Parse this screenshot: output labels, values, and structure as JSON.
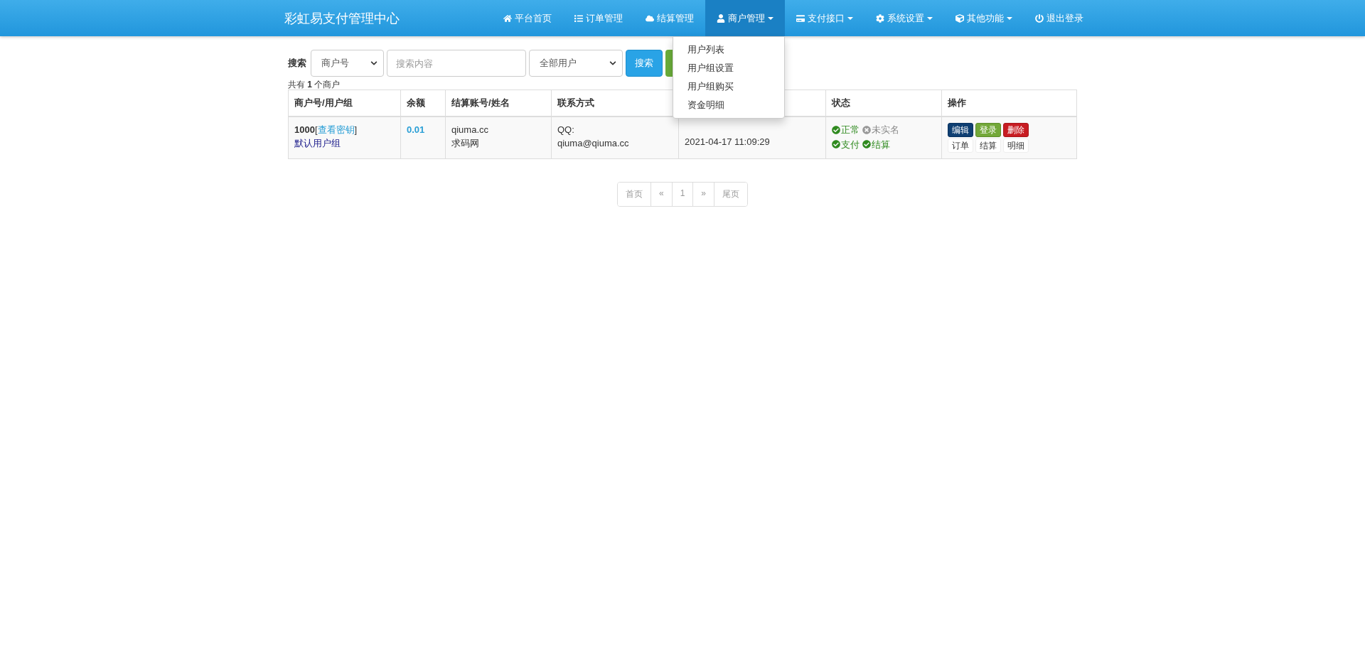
{
  "navbar": {
    "brand": "彩虹易支付管理中心",
    "items": [
      {
        "label": "平台首页",
        "selected": false,
        "dropdown": false
      },
      {
        "label": "订单管理",
        "selected": false,
        "dropdown": false
      },
      {
        "label": "结算管理",
        "selected": false,
        "dropdown": false
      },
      {
        "label": "商户管理",
        "selected": true,
        "dropdown": true
      },
      {
        "label": "支付接口",
        "selected": false,
        "dropdown": true
      },
      {
        "label": "系统设置",
        "selected": false,
        "dropdown": true
      },
      {
        "label": "其他功能",
        "selected": false,
        "dropdown": true
      },
      {
        "label": "退出登录",
        "selected": false,
        "dropdown": false
      }
    ]
  },
  "dropdown_menu": {
    "items": [
      "用户列表",
      "用户组设置",
      "用户组购买",
      "资金明细"
    ]
  },
  "search": {
    "label": "搜索",
    "field_select": "商户号",
    "placeholder": "搜索内容",
    "group_select": "全部用户",
    "button": "搜索"
  },
  "summary": {
    "prefix": "共有",
    "count": "1",
    "suffix": "个商户"
  },
  "table": {
    "columns": [
      "商户号/用户组",
      "余额",
      "结算账号/姓名",
      "联系方式",
      null,
      "状态",
      "操作"
    ],
    "rows": [
      {
        "id": "1000",
        "key_open": "[",
        "key_link": "查看密钥",
        "key_close": "]",
        "group": "默认用户组",
        "balance": "0.01",
        "account": "qiuma.cc",
        "name": "求码网",
        "contact_label": "QQ:",
        "contact": "qiuma@qiuma.cc",
        "time": "2021-04-17 11:09:29",
        "status": [
          {
            "label": "正常",
            "on": true
          },
          {
            "label": "未实名",
            "on": false
          },
          {
            "label": "支付",
            "on": true
          },
          {
            "label": "结算",
            "on": true
          }
        ],
        "actions": [
          {
            "label": "编辑",
            "kind": "primary"
          },
          {
            "label": "登录",
            "kind": "success"
          },
          {
            "label": "删除",
            "kind": "danger"
          },
          {
            "label": "订单",
            "kind": "default"
          },
          {
            "label": "结算",
            "kind": "default"
          },
          {
            "label": "明细",
            "kind": "default"
          }
        ]
      }
    ]
  },
  "pagination": [
    {
      "label": "首页",
      "selected": false
    },
    {
      "label": "«",
      "selected": false
    },
    {
      "label": "1",
      "selected": false
    },
    {
      "label": "»",
      "selected": false
    },
    {
      "label": "尾页",
      "selected": false
    }
  ]
}
